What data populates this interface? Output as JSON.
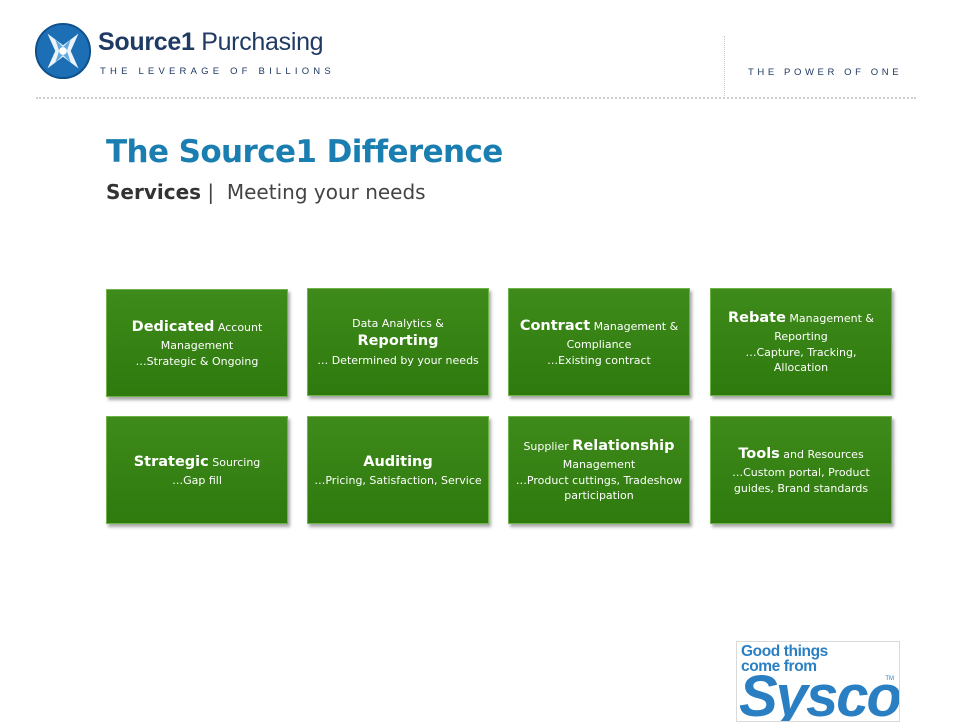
{
  "header": {
    "brand_bold": "Source1",
    "brand_rest": " Purchasing",
    "brand_tagline": "THE LEVERAGE OF BILLIONS",
    "right_tagline": "THE POWER OF ONE"
  },
  "slide": {
    "title": "The Source1 Difference",
    "subtitle_bold": "Services",
    "subtitle_sep": " |  ",
    "subtitle_rest": "Meeting your needs"
  },
  "tiles": [
    {
      "t1": "Dedicated",
      "t2": " Account Management",
      "t3": "…Strategic & Ongoing"
    },
    {
      "t1": "Data Analytics &",
      "t2": "Reporting",
      "t3": "… Determined by your needs"
    },
    {
      "t1": "Contract",
      "t2": " Management & Compliance",
      "t3": "…Existing contract"
    },
    {
      "t1": "Rebate",
      "t2": " Management & Reporting",
      "t3": "…Capture, Tracking, Allocation"
    },
    {
      "t1": "Strategic",
      "t2": " Sourcing",
      "t3": "…Gap fill"
    },
    {
      "t1": "Auditing",
      "t2": "",
      "t3": "…Pricing, Satisfaction, Service"
    },
    {
      "t1": "Supplier ",
      "t2": "Relationship",
      "t3": "Management",
      "t4": "…Product cuttings, Tradeshow participation"
    },
    {
      "t1": "Tools",
      "t2": " and Resources",
      "t3": "…Custom portal, Product guides, Brand standards"
    }
  ],
  "sysco": {
    "line1": "Good things",
    "line2": "come from",
    "word": "Sysco",
    "tm": "TM"
  },
  "colors": {
    "title_blue": "#1a7fb0",
    "navy": "#1f3a63",
    "tile_green": "#3e8a1a",
    "sysco_blue": "#2a7fc3"
  }
}
